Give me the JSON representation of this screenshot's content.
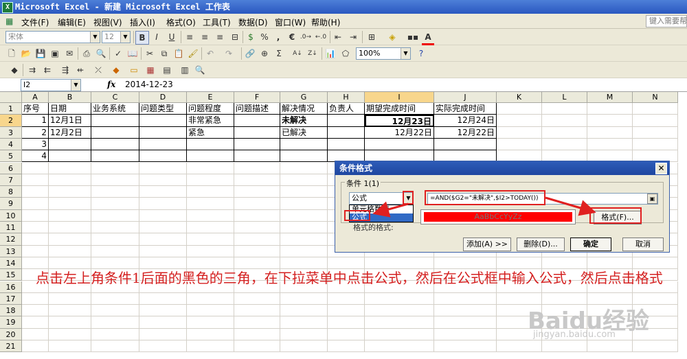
{
  "window": {
    "title": "Microsoft Excel - 新建 Microsoft Excel 工作表",
    "icon": "excel-icon"
  },
  "menu": {
    "items": [
      "文件(F)",
      "编辑(E)",
      "视图(V)",
      "插入(I)",
      "格式(O)",
      "工具(T)",
      "数据(D)",
      "窗口(W)",
      "帮助(H)"
    ],
    "help_placeholder": "键入需要帮"
  },
  "format_toolbar": {
    "font": "宋体",
    "size": "12",
    "bold": "B",
    "italic": "I",
    "underline": "U",
    "percent": "%",
    "comma": ",",
    "euro": "€"
  },
  "standard_toolbar": {
    "zoom": "100%",
    "sum": "Σ"
  },
  "formula_bar": {
    "name_box": "I2",
    "fx": "fx",
    "value": "2014-12-23"
  },
  "columns": [
    "A",
    "B",
    "C",
    "D",
    "E",
    "F",
    "G",
    "H",
    "I",
    "J",
    "K",
    "L",
    "M",
    "N"
  ],
  "rows": [
    "1",
    "2",
    "3",
    "4",
    "5",
    "6",
    "7",
    "8",
    "9",
    "10",
    "11",
    "12",
    "13",
    "14",
    "15",
    "16",
    "17",
    "18",
    "19",
    "20",
    "21"
  ],
  "table": {
    "headers": [
      "序号",
      "日期",
      "业务系统",
      "问题类型",
      "问题程度",
      "问题描述",
      "解决情况",
      "负责人",
      "期望完成时间",
      "实际完成时间"
    ],
    "rows": [
      [
        "1",
        "12月1日",
        "",
        "",
        "非常紧急",
        "",
        "未解决",
        "",
        "12月23日",
        "12月24日"
      ],
      [
        "2",
        "12月2日",
        "",
        "",
        "紧急",
        "",
        "已解决",
        "",
        "12月22日",
        "12月22日"
      ],
      [
        "3",
        "",
        "",
        "",
        "",
        "",
        "",
        "",
        "",
        ""
      ],
      [
        "4",
        "",
        "",
        "",
        "",
        "",
        "",
        "",
        "",
        ""
      ]
    ]
  },
  "dialog": {
    "title": "条件格式",
    "condition_label": "条件 1(1)",
    "type_value": "公式",
    "dropdown_options": [
      "单元格数值",
      "公式"
    ],
    "partial_text": "格式的格式:",
    "formula": "=AND($G2=\"未解决\",$I2>TODAY())",
    "preview": "AaBbCcYyZz",
    "format_button": "格式(F)...",
    "add_button": "添加(A) >>",
    "delete_button": "删除(D)...",
    "ok_button": "确定",
    "cancel_button": "取消"
  },
  "instruction": "点击左上角条件1后面的黑色的三角，在下拉菜单中点击公式，然后在公式框中输入公式，然后点击格式",
  "watermark": {
    "text": "Baidu经验",
    "url": "jingyan.baidu.com"
  },
  "colors": {
    "preview_fill": "#ff0000",
    "instruction": "#d42020",
    "highlight": "#e02020"
  }
}
